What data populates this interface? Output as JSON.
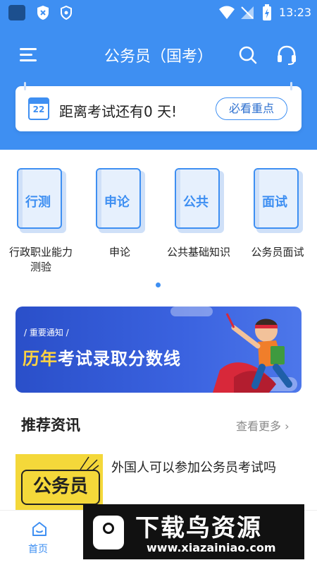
{
  "colors": {
    "primary": "#3e8ff2",
    "banner_highlight": "#ffd340",
    "thumb_yellow": "#f4d83a"
  },
  "status_bar": {
    "time": "13:23"
  },
  "header": {
    "title": "公务员（国考）"
  },
  "countdown": {
    "calendar_day": "22",
    "text": "距离考试还有0 天!",
    "button_label": "必看重点"
  },
  "categories": [
    {
      "tag": "行测",
      "label": "行政职业能力测验"
    },
    {
      "tag": "申论",
      "label": "申论"
    },
    {
      "tag": "公共",
      "label": "公共基础知识"
    },
    {
      "tag": "面试",
      "label": "公务员面试"
    }
  ],
  "banner": {
    "tag": "/ 重要通知 /",
    "title_highlight": "历年",
    "title_rest": "考试录取分数线"
  },
  "news_section": {
    "title": "推荐资讯",
    "more_label": "查看更多",
    "items": [
      {
        "thumb_text": "公务员",
        "title": "外国人可以参加公务员考试吗"
      }
    ]
  },
  "tabbar": {
    "home_label": "首页"
  },
  "watermark": {
    "title": "下载鸟资源",
    "url": "www.xiazainiao.com"
  }
}
